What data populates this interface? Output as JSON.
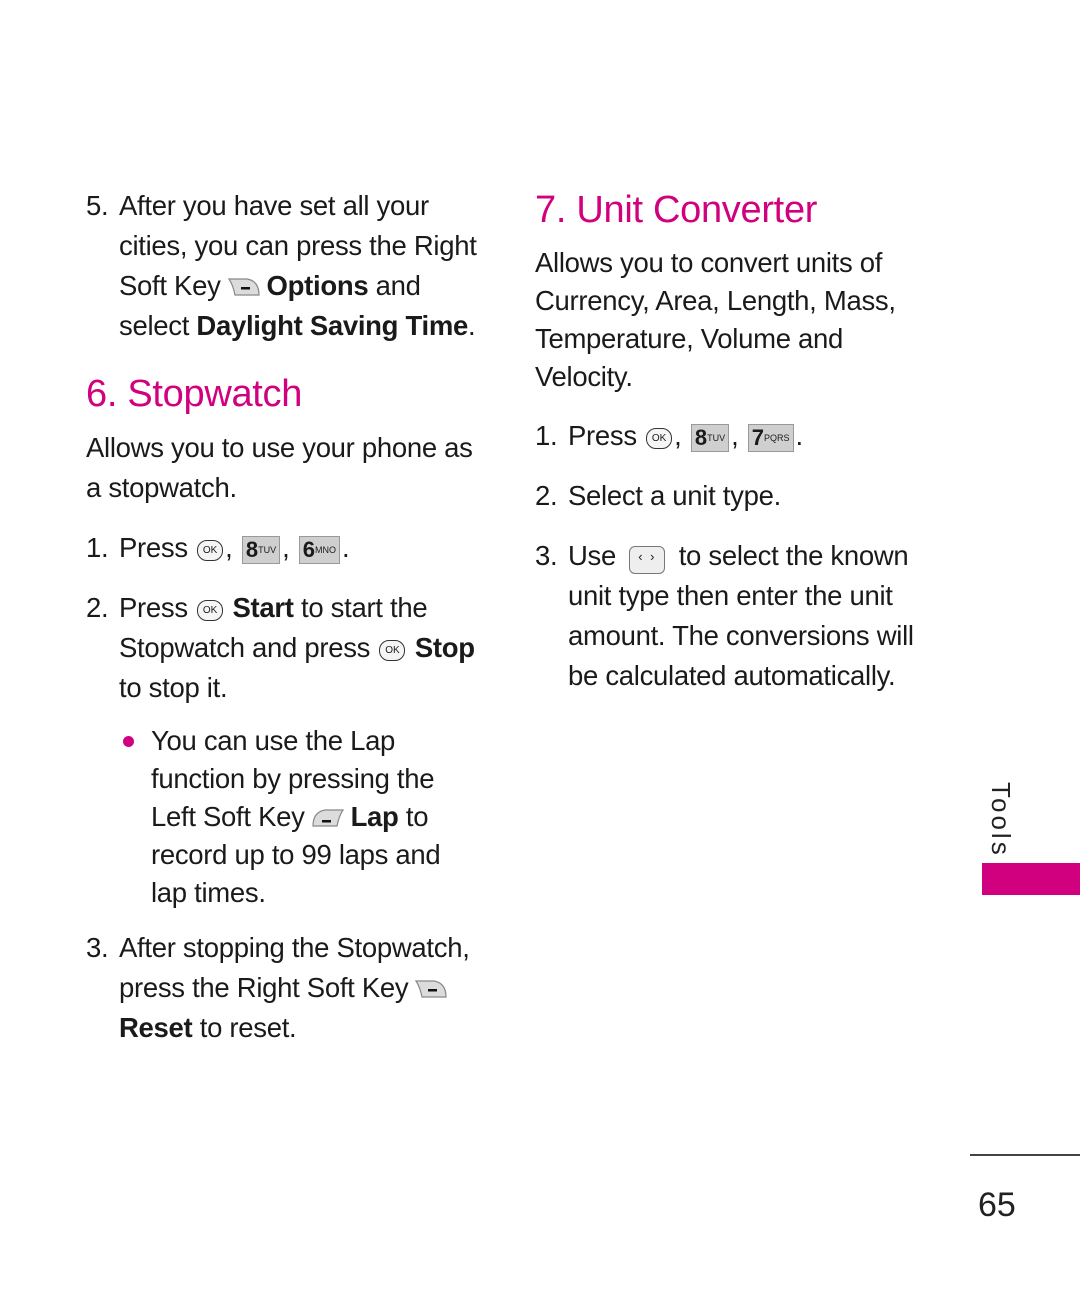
{
  "left_column": {
    "step5": {
      "num": "5.",
      "l1": "After you have set all your",
      "l2": "cities, you can press the Right",
      "l3a": "Soft Key",
      "l3b": "Options",
      "l3c": "and",
      "l4a": "select",
      "l4b": "Daylight Saving Time",
      "l4c": "."
    },
    "heading": "6. Stopwatch",
    "intro": [
      "Allows you to use your phone as",
      "a stopwatch."
    ],
    "step1": {
      "num": "1.",
      "text": "Press",
      "ok": "OK",
      "key1_digit": "8",
      "key1_letters": "TUV",
      "key2_digit": "6",
      "key2_letters": "MNO"
    },
    "step2": {
      "num": "2.",
      "a": "Press",
      "ok": "OK",
      "b": "Start",
      "c": "to start the",
      "d": "Stopwatch and press",
      "e": "Stop",
      "f": "to stop it."
    },
    "bullet": {
      "l1": "You can use the Lap",
      "l2": "function by pressing the",
      "l3a": "Left Soft Key",
      "l3b": "Lap",
      "l3c": "to",
      "l4": "record up to 99 laps and",
      "l5": "lap times."
    },
    "step3": {
      "num": "3.",
      "l1": "After stopping the Stopwatch,",
      "l2": "press the Right Soft Key",
      "l3a": "Reset",
      "l3b": "to reset."
    }
  },
  "right_column": {
    "heading": "7. Unit Converter",
    "intro": [
      "Allows you to convert units of",
      "Currency, Area, Length, Mass,",
      "Temperature, Volume and",
      "Velocity."
    ],
    "step1": {
      "num": "1.",
      "text": "Press",
      "ok": "OK",
      "key1_digit": "8",
      "key1_letters": "TUV",
      "key2_digit": "7",
      "key2_letters": "PQRS"
    },
    "step2": {
      "num": "2.",
      "text": "Select a unit type."
    },
    "step3": {
      "num": "3.",
      "a": "Use",
      "nav": "‹ ›",
      "b": "to select the known",
      "l2": "unit type then enter the unit",
      "l3": "amount. The conversions will",
      "l4": "be calculated automatically."
    }
  },
  "side_tab": {
    "label": "Tools",
    "color": "#d1007e"
  },
  "page_number": "65"
}
